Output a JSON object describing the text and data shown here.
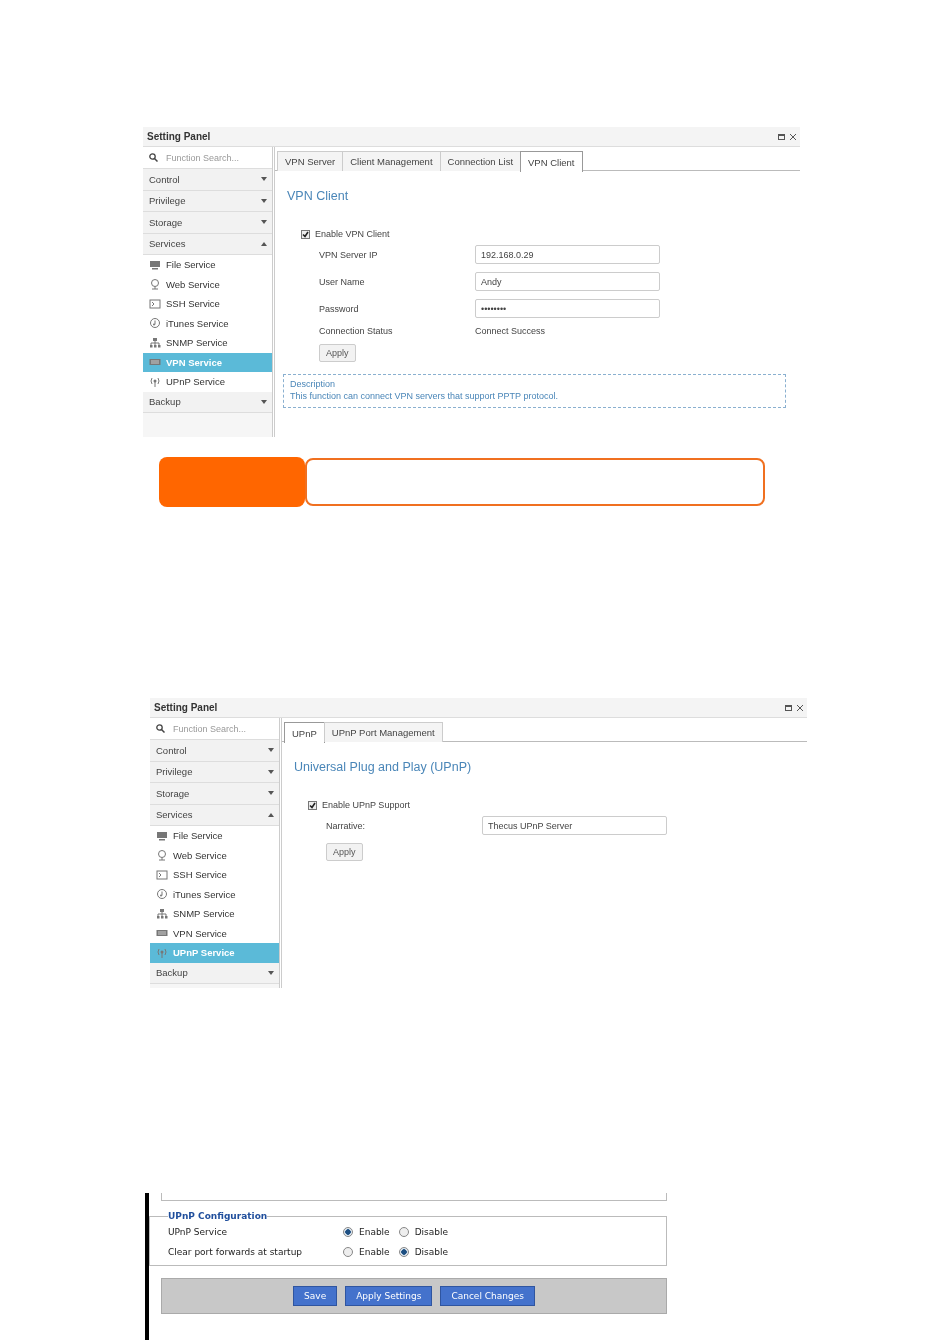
{
  "panels": [
    {
      "title": "Setting Panel",
      "search_placeholder": "Function Search...",
      "sidebar": [
        {
          "label": "Control",
          "expanded": false
        },
        {
          "label": "Privilege",
          "expanded": false
        },
        {
          "label": "Storage",
          "expanded": false
        },
        {
          "label": "Services",
          "expanded": true,
          "children": [
            {
              "label": "File Service",
              "selected": false
            },
            {
              "label": "Web Service",
              "selected": false
            },
            {
              "label": "SSH Service",
              "selected": false
            },
            {
              "label": "iTunes Service",
              "selected": false
            },
            {
              "label": "SNMP Service",
              "selected": false
            },
            {
              "label": "VPN Service",
              "selected": true
            },
            {
              "label": "UPnP Service",
              "selected": false
            }
          ]
        },
        {
          "label": "Backup",
          "expanded": false
        }
      ],
      "tabs": [
        {
          "label": "VPN Server",
          "selected": false
        },
        {
          "label": "Client Management",
          "selected": false
        },
        {
          "label": "Connection List",
          "selected": false
        },
        {
          "label": "VPN Client",
          "selected": true
        }
      ],
      "heading": "VPN Client",
      "checkbox": {
        "label": "Enable VPN Client",
        "checked": true
      },
      "fields": [
        {
          "kind": "input",
          "label": "VPN Server IP",
          "value": "192.168.0.29"
        },
        {
          "kind": "input",
          "label": "User Name",
          "value": "Andy"
        },
        {
          "kind": "input",
          "label": "Password",
          "value": "••••••••"
        },
        {
          "kind": "text",
          "label": "Connection Status",
          "value": "Connect Success"
        }
      ],
      "apply_button": "Apply",
      "description": {
        "title": "Description",
        "text": "This function can connect VPN servers that support PPTP protocol."
      }
    },
    {
      "title": "Setting Panel",
      "search_placeholder": "Function Search...",
      "sidebar": [
        {
          "label": "Control",
          "expanded": false
        },
        {
          "label": "Privilege",
          "expanded": false
        },
        {
          "label": "Storage",
          "expanded": false
        },
        {
          "label": "Services",
          "expanded": true,
          "children": [
            {
              "label": "File Service",
              "selected": false
            },
            {
              "label": "Web Service",
              "selected": false
            },
            {
              "label": "SSH Service",
              "selected": false
            },
            {
              "label": "iTunes Service",
              "selected": false
            },
            {
              "label": "SNMP Service",
              "selected": false
            },
            {
              "label": "VPN Service",
              "selected": false
            },
            {
              "label": "UPnP Service",
              "selected": true
            }
          ]
        },
        {
          "label": "Backup",
          "expanded": false
        }
      ],
      "tabs": [
        {
          "label": "UPnP",
          "selected": true
        },
        {
          "label": "UPnP Port Management",
          "selected": false
        }
      ],
      "heading": "Universal Plug and Play (UPnP)",
      "checkbox": {
        "label": "Enable UPnP Support",
        "checked": true
      },
      "fields": [
        {
          "kind": "input",
          "label": "Narrative:",
          "value": "Thecus UPnP Server"
        }
      ],
      "apply_button": "Apply"
    }
  ],
  "router_config": {
    "legend": "UPnP Configuration",
    "rows": [
      {
        "label": "UPnP Service",
        "options": [
          {
            "label": "Enable",
            "selected": true
          },
          {
            "label": "Disable",
            "selected": false
          }
        ]
      },
      {
        "label": "Clear port forwards at startup",
        "options": [
          {
            "label": "Enable",
            "selected": false
          },
          {
            "label": "Disable",
            "selected": true
          }
        ]
      }
    ],
    "buttons": [
      "Save",
      "Apply Settings",
      "Cancel Changes"
    ]
  }
}
